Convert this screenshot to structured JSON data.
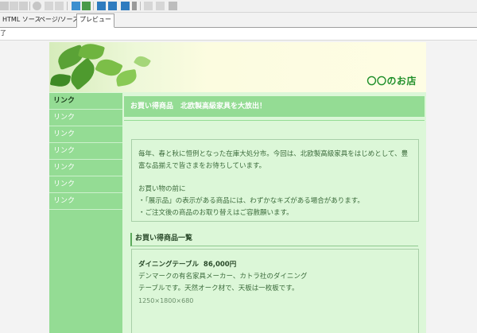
{
  "editor": {
    "tabs": [
      "HTML ソース",
      "ページ/ソース",
      "プレビュー"
    ],
    "status_text": "了"
  },
  "page": {
    "site_name": "〇〇のお店",
    "sidebar_links": [
      "リンク",
      "リンク",
      "リンク",
      "リンク",
      "リンク",
      "リンク",
      "リンク"
    ],
    "banner": "お買い得商品　北欧製高級家具を大放出！",
    "intro": {
      "paragraph1": "毎年、春と秋に恒例となった在庫大処分市。今回は、北欧製高級家具をはじめとして、豊富な品揃えで皆さまをお待ちしています。",
      "notice_title": "お買い物の前に",
      "notice_1": "・「展示品」の表示がある商品には、わずかなキズがある場合があります。",
      "notice_2": "・ご注文後の商品のお取り替えはご容赦願います。"
    },
    "list_heading": "お買い得商品一覧",
    "product": {
      "name": "ダイニングテーブル",
      "price": "86,000円",
      "description_line1": "デンマークの有名家具メーカー、カトラ社のダイニング",
      "description_line2": "テーブルです。天然オーク材で、天板は一枚板です。",
      "size": "1250×1800×680"
    }
  },
  "colors": {
    "accent_green": "#94dc94",
    "page_bg": "#dcf7d8",
    "brand_text": "#1f8f2a"
  }
}
